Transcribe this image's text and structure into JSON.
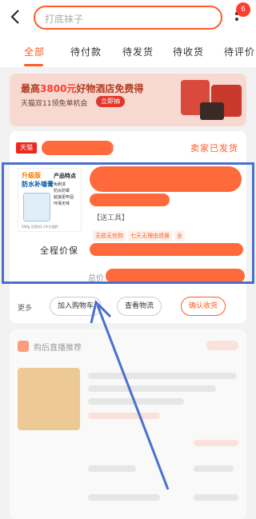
{
  "header": {
    "search_placeholder": "打底袜子",
    "badge_count": "6"
  },
  "tabs": [
    {
      "label": "全部",
      "active": true
    },
    {
      "label": "待付款"
    },
    {
      "label": "待发货"
    },
    {
      "label": "待收货"
    },
    {
      "label": "待评价"
    }
  ],
  "banner": {
    "title_prefix": "最高",
    "title_highlight": "3800元",
    "title_suffix": "好物酒店免费得",
    "subtitle": "天猫双11领免单机会",
    "button": "立即抽"
  },
  "order": {
    "shop_logo": "天猫",
    "status": "卖家已发货",
    "product_image": {
      "title1": "升级版",
      "title2": "防水补墙膏",
      "features_title": "产品特点",
      "features": [
        "免刷漆",
        "防水防霉",
        "粘接更牢固",
        "环保无味"
      ],
      "footer": "500g 可用约1.5平方面积"
    },
    "spec": "【送工具】",
    "tags": [
      "无损无忧购",
      "七天无理由退换",
      "全"
    ],
    "guarantee_label": "全程价保",
    "total_label": "总价",
    "more_label": "更多",
    "actions": [
      "加入购物车",
      "查看物流",
      "确认收货"
    ]
  },
  "recommend": {
    "title": "购后直播推荐"
  },
  "annotation": {
    "color": "#4a6fcf"
  }
}
